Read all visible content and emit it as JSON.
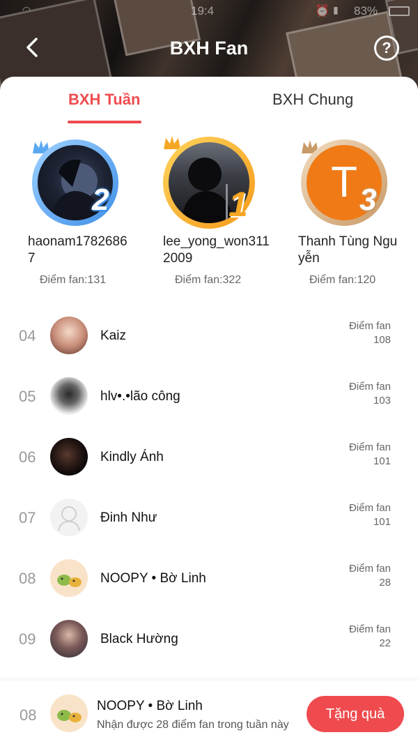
{
  "status_bar": {
    "time": "19:4",
    "battery": "83%"
  },
  "header": {
    "title": "BXH Fan",
    "help_label": "?"
  },
  "tabs": [
    {
      "label": "BXH Tuần",
      "active": true
    },
    {
      "label": "BXH Chung",
      "active": false
    }
  ],
  "colors": {
    "accent": "#ef4b4f",
    "gold": "#f5a623",
    "silver_blue": "#3f8fe8",
    "bronze": "#c99a67"
  },
  "podium": [
    {
      "position": 2,
      "rank_label": "2",
      "name": "haonam17826867",
      "score": "Điểm fan:131"
    },
    {
      "position": 1,
      "rank_label": "1",
      "name": "lee_yong_won3112009",
      "score": "Điểm fan:322"
    },
    {
      "position": 3,
      "rank_label": "3",
      "name": "Thanh Tùng Nguyễn",
      "score": "Điểm fan:120",
      "avatar_letter": "T"
    }
  ],
  "rows": [
    {
      "rank": "04",
      "name": "Kaiz",
      "score_label": "Điểm fan",
      "score": "108"
    },
    {
      "rank": "05",
      "name": "hlv•.•lão công",
      "score_label": "Điểm fan",
      "score": "103"
    },
    {
      "rank": "06",
      "name": "Kindly Ánh",
      "score_label": "Điểm fan",
      "score": "101"
    },
    {
      "rank": "07",
      "name": "Đinh Như",
      "score_label": "Điểm fan",
      "score": "101"
    },
    {
      "rank": "08",
      "name": "NOOPY • Bờ Linh",
      "score_label": "Điểm fan",
      "score": "28"
    },
    {
      "rank": "09",
      "name": "Black Hường",
      "score_label": "Điểm fan",
      "score": "22"
    }
  ],
  "my_rank": {
    "rank": "08",
    "name": "NOOPY • Bờ Linh",
    "subtitle": "Nhận được 28 điểm fan trong tuần này",
    "button": "Tặng quà"
  }
}
